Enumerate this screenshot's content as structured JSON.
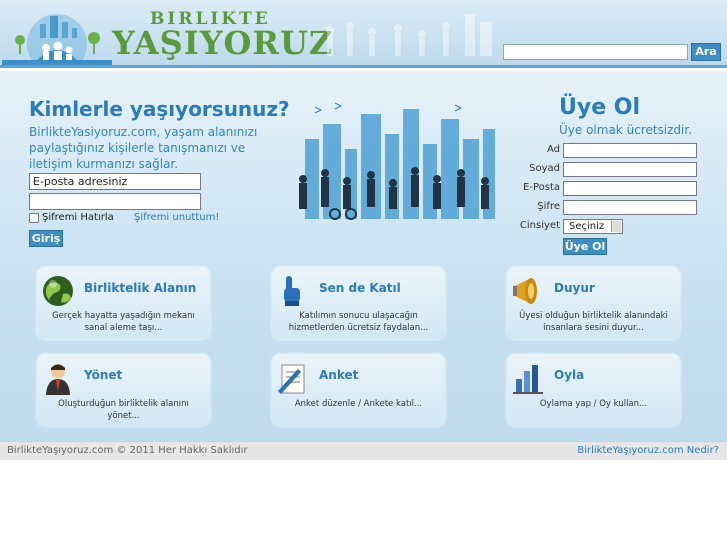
{
  "header": {
    "logo_top": "BIRLIKTE",
    "logo_bottom": "YAŞIYORUZ",
    "search_placeholder": "",
    "search_button": "Ara"
  },
  "login": {
    "headline": "Kimlerle yaşıyorsunuz?",
    "intro": "BirlikteYasiyoruz.com, yaşam alanınızı paylaştığınız kişilerle tanışmanızı ve iletişim kurmanızı sağlar.",
    "email_value": "E-posta adresiniz",
    "password_value": "",
    "remember_label": "Şifremi Hatırla",
    "forgot_link": "Şifremi unuttum!",
    "login_button": "Giriş"
  },
  "signup": {
    "title": "Üye Ol",
    "subtitle": "Üye olmak ücretsizdir.",
    "labels": {
      "name": "Ad",
      "surname": "Soyad",
      "email": "E-Posta",
      "password": "Şifre",
      "gender": "Cinsiyet"
    },
    "gender_selected": "Seçiniz",
    "signup_button": "Üye Ol"
  },
  "features": [
    {
      "title": "Birliktelik Alanın",
      "desc": "Gerçek hayatta yaşadığın mekanı sanal aleme taşı...",
      "icon": "globe-icon"
    },
    {
      "title": "Sen de Katıl",
      "desc": "Katılımın sonucu ulaşacağın hizmetlerden ücretsiz faydalan...",
      "icon": "pointing-hand-icon"
    },
    {
      "title": "Duyur",
      "desc": "Üyesi olduğun birliktelik alanındaki insanlara sesini duyur...",
      "icon": "megaphone-icon"
    },
    {
      "title": "Yönet",
      "desc": "Oluşturduğun birliktelik alanını yönet...",
      "icon": "manager-icon"
    },
    {
      "title": "Anket",
      "desc": "Anket düzenle / Ankete katıl...",
      "icon": "survey-icon"
    },
    {
      "title": "Oyla",
      "desc": "Oylama yap / Oy kullan...",
      "icon": "bar-chart-icon"
    }
  ],
  "footer": {
    "copyright": "BirlikteYaşıyoruz.com © 2011 Her Hakkı Saklıdır",
    "about_link": "BirlikteYaşıyoruz.com Nedir?"
  },
  "colors": {
    "accent": "#2a7bbf",
    "button": "#3b8fc6",
    "logo_green": "#5a9a3b"
  }
}
